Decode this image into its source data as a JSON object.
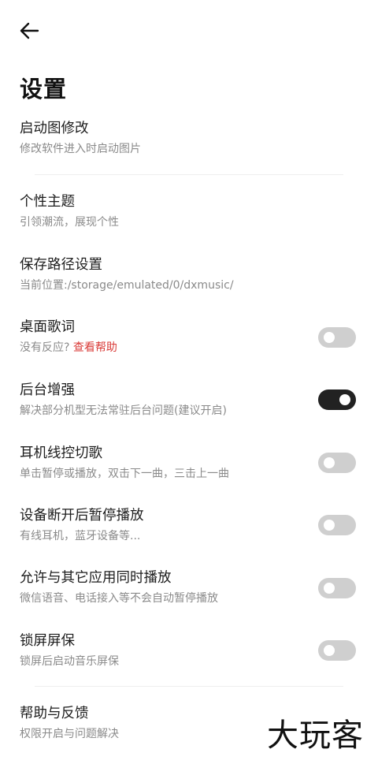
{
  "header": {
    "title": "设置"
  },
  "settings": [
    {
      "title": "启动图修改",
      "subtitle": "修改软件进入时启动图片"
    },
    {
      "title": "个性主题",
      "subtitle": "引领潮流，展现个性"
    },
    {
      "title": "保存路径设置",
      "subtitle": "当前位置:/storage/emulated/0/dxmusic/"
    },
    {
      "title": "桌面歌词",
      "subtitle": "没有反应?",
      "link": "查看帮助",
      "toggle": "off"
    },
    {
      "title": "后台增强",
      "subtitle": "解决部分机型无法常驻后台问题(建议开启)",
      "toggle": "on"
    },
    {
      "title": "耳机线控切歌",
      "subtitle": "单击暂停或播放，双击下一曲，三击上一曲",
      "toggle": "off"
    },
    {
      "title": "设备断开后暂停播放",
      "subtitle": "有线耳机，蓝牙设备等...",
      "toggle": "off"
    },
    {
      "title": "允许与其它应用同时播放",
      "subtitle": "微信语音、电话接入等不会自动暂停播放",
      "toggle": "off"
    },
    {
      "title": "锁屏屏保",
      "subtitle": "锁屏后启动音乐屏保",
      "toggle": "off"
    },
    {
      "title": "帮助与反馈",
      "subtitle": "权限开启与问题解决"
    }
  ],
  "watermark": "大玩客",
  "colors": {
    "accent_link": "#d93a37",
    "toggle_on": "#222222",
    "toggle_off": "#cfcfcf"
  }
}
